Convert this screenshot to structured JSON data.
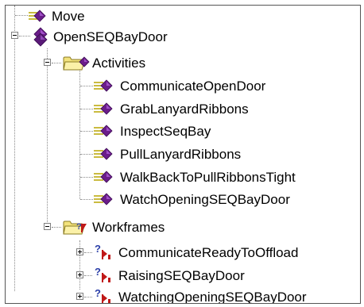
{
  "tree": {
    "items": {
      "move": "Move",
      "open_seq_bay_door": "OpenSEQBayDoor",
      "activities": "Activities",
      "act_0": "CommunicateOpenDoor",
      "act_1": "GrabLanyardRibbons",
      "act_2": "InspectSeqBay",
      "act_3": "PullLanyardRibbons",
      "act_4": "WalkBackToPullRibbonsTight",
      "act_5": "WatchOpeningSEQBayDoor",
      "workframes": "Workframes",
      "wf_0": "CommunicateReadyToOffload",
      "wf_1": "RaisingSEQBayDoor",
      "wf_2": "WatchingOpeningSEQBayDoor"
    },
    "icons": {
      "activity": "activity-icon",
      "folder": "folder-icon",
      "workframe": "workframe-icon",
      "expand": "expand-plus-icon",
      "collapse": "collapse-minus-icon"
    },
    "colors": {
      "activity": "#6b1d8a",
      "folder": "#f2e27c",
      "workframe_q": "#2b3fa8",
      "workframe_red": "#c01818"
    }
  }
}
